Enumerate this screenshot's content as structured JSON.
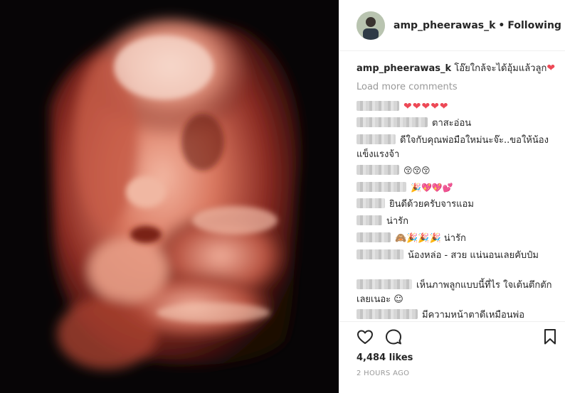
{
  "post": {
    "username": "amp_pheerawas_k",
    "separator": "•",
    "follow_status": "Following",
    "caption_text": "โอ๊ยใกล้จะได้อุ้มแล้วลูก",
    "caption_emoji": "❤",
    "load_more": "Load more comments",
    "likes": "4,484 likes",
    "timestamp": "2 HOURS AGO"
  },
  "comments": [
    {
      "text": "",
      "extra": "❤❤❤❤❤"
    },
    {
      "text": "ตาสะอ่อน",
      "extra": ""
    },
    {
      "text": "ดีใจกับคุณพ่อมือใหม่นะจ๊ะ..ขอให้น้องแข็งแรงจ้า",
      "extra": ""
    },
    {
      "text": "",
      "extra": "😚😚😚"
    },
    {
      "text": "",
      "extra": "🎉💖💖💕"
    },
    {
      "text": "ยินดีด้วยครับจารแอม",
      "extra": ""
    },
    {
      "text": "น่ารัก",
      "extra": ""
    },
    {
      "text": "🙈🎉🎉🎉 น่ารัก",
      "extra": ""
    },
    {
      "text": "น้องหล่อ - สวย แน่นอนเลยคับป๋ม",
      "extra": ""
    },
    {
      "text": "เห็นภาพลูกแบบนี้ที่ไร ใจเต้นตึกตักเลยเนอะ ☺",
      "extra": ""
    },
    {
      "text": "มีความหน้าตาดีเหมือนพ่อ",
      "extra": ""
    }
  ],
  "colors": {
    "heart": "#ed4956",
    "text": "#262626",
    "muted": "#999999",
    "divider": "#efefef"
  },
  "icons": [
    "heart-icon",
    "comment-icon",
    "bookmark-icon"
  ]
}
